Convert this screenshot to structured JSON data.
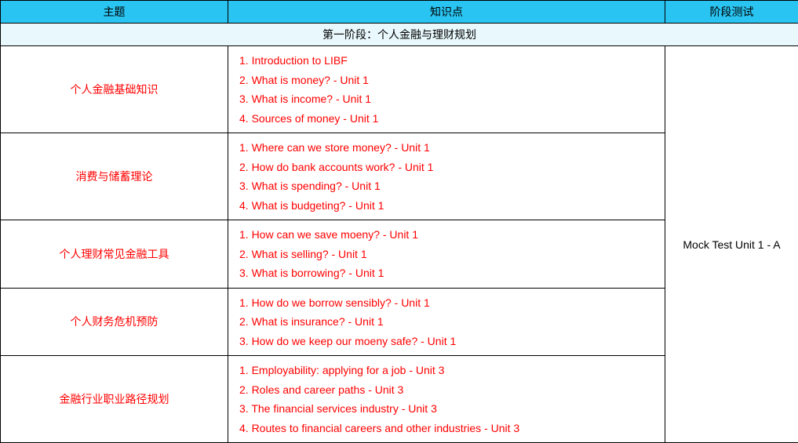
{
  "headers": {
    "topic": "主题",
    "knowledge": "知识点",
    "test": "阶段测试"
  },
  "stage": {
    "title": "第一阶段：个人金融与理财规划"
  },
  "rows": [
    {
      "topic": "个人金融基础知识",
      "points": [
        "1. Introduction to LIBF",
        "2. What is money? - Unit 1",
        "3. What is income? - Unit 1",
        "4. Sources of money - Unit 1"
      ]
    },
    {
      "topic": "消费与储蓄理论",
      "points": [
        "1. Where can we store money? - Unit 1",
        "2. How do bank accounts work? - Unit 1",
        "3. What is spending? - Unit 1",
        "4. What is budgeting? - Unit 1"
      ]
    },
    {
      "topic": "个人理财常见金融工具",
      "points": [
        "1. How can we save moeny? - Unit 1",
        "2. What is selling? - Unit 1",
        "3. What is borrowing? - Unit 1"
      ]
    },
    {
      "topic": "个人财务危机预防",
      "points": [
        "1. How do we borrow sensibly? - Unit 1",
        "2. What is insurance? - Unit 1",
        "3. How do we keep our moeny safe? - Unit 1"
      ]
    },
    {
      "topic": "金融行业职业路径规划",
      "points": [
        "1. Employability: applying for a job - Unit 3",
        "2. Roles and career paths - Unit 3",
        "3. The financial services industry - Unit 3",
        "4. Routes to financial careers and other industries - Unit 3"
      ]
    }
  ],
  "test": {
    "label": "Mock Test Unit 1 - A"
  }
}
